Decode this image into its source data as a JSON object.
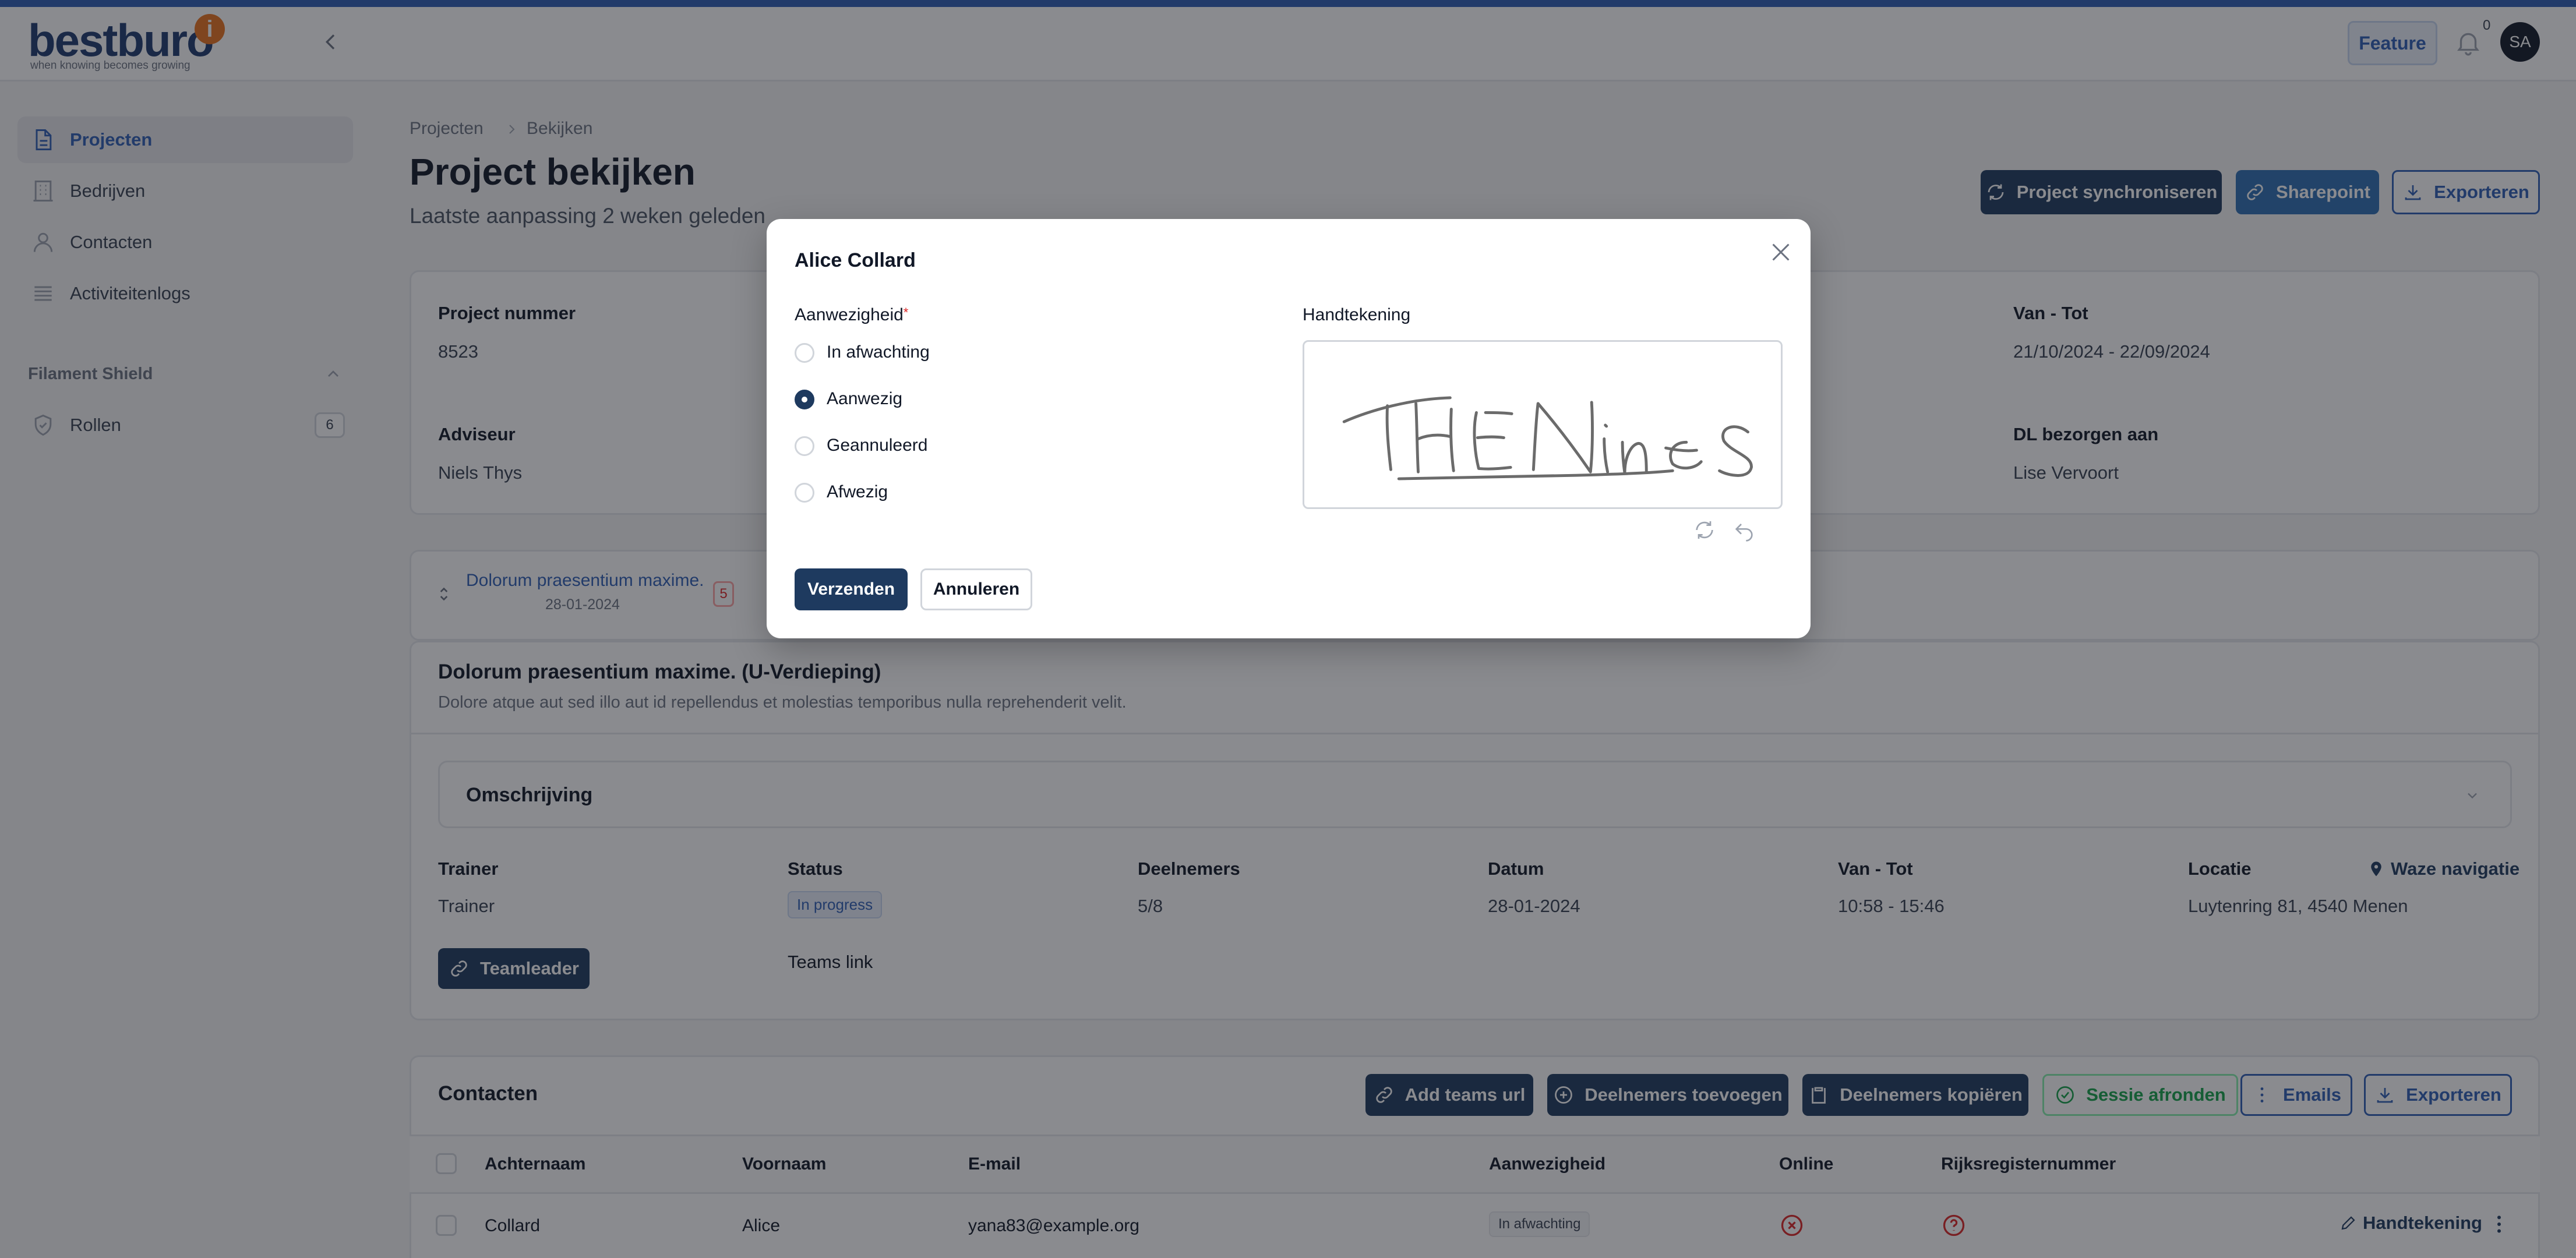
{
  "app": {
    "logo_text": "bestburo",
    "logo_mark": "i",
    "tagline": "when knowing becomes growing",
    "feature_label": "Feature",
    "notification_count": "0",
    "avatar_initials": "SA"
  },
  "sidebar": {
    "items": [
      {
        "label": "Projecten",
        "icon": "document-icon"
      },
      {
        "label": "Bedrijven",
        "icon": "building-icon"
      },
      {
        "label": "Contacten",
        "icon": "user-icon"
      },
      {
        "label": "Activiteitenlogs",
        "icon": "list-icon"
      }
    ],
    "group": {
      "label": "Filament Shield",
      "items": [
        {
          "label": "Rollen",
          "icon": "shield-icon",
          "badge": "6"
        }
      ]
    }
  },
  "breadcrumb": [
    "Projecten",
    "Bekijken"
  ],
  "page": {
    "title": "Project bekijken",
    "subtitle": "Laatste aanpassing 2 weken geleden",
    "actions": [
      "Project synchroniseren",
      "Sharepoint",
      "Exporteren"
    ]
  },
  "project": {
    "number_label": "Project nummer",
    "number": "8523",
    "period_label": "Van - Tot",
    "period": "21/10/2024 - 22/09/2024",
    "advisor_label": "Adviseur",
    "advisor": "Niels Thys",
    "dl_label": "DL bezorgen aan",
    "dl": "Lise Vervoort"
  },
  "session_selector": {
    "title": "Dolorum praesentium maxime.",
    "date": "28-01-2024",
    "count": "5"
  },
  "session": {
    "title": "Dolorum praesentium maxime. (U-Verdieping)",
    "description": "Dolore atque aut sed illo aut id repellendus et molestias temporibus nulla reprehenderit velit.",
    "section": "Omschrijving",
    "trainer_label": "Trainer",
    "trainer": "Trainer",
    "status_label": "Status",
    "status": "In progress",
    "participants_label": "Deelnemers",
    "participants": "5/8",
    "date_label": "Datum",
    "date": "28-01-2024",
    "time_label": "Van - Tot",
    "time": "10:58 - 15:46",
    "location_label": "Locatie",
    "location": "Luytenring 81, 4540 Menen",
    "waze": "Waze navigatie",
    "teamleader": "Teamleader",
    "teams_link": "Teams link"
  },
  "contacts": {
    "title": "Contacten",
    "actions": [
      "Add teams url",
      "Deelnemers toevoegen",
      "Deelnemers kopiëren",
      "Sessie afronden",
      "Emails",
      "Exporteren"
    ],
    "columns": [
      "Achternaam",
      "Voornaam",
      "E-mail",
      "Aanwezigheid",
      "Online",
      "Rijksregisternummer"
    ],
    "rows": [
      {
        "last": "Collard",
        "first": "Alice",
        "email": "yana83@example.org",
        "presence": "In afwachting",
        "action": "Handtekening"
      }
    ]
  },
  "modal": {
    "title": "Alice Collard",
    "presence_label": "Aanwezigheid",
    "required_mark": "*",
    "options": [
      "In afwachting",
      "Aanwezig",
      "Geannuleerd",
      "Afwezig"
    ],
    "selected": "Aanwezig",
    "signature_label": "Handtekening",
    "submit": "Verzenden",
    "cancel": "Annuleren"
  },
  "colors": {
    "primary": "#1e3a5f",
    "accent": "#2f5fb5",
    "success": "#16a34a",
    "danger": "#dc2626"
  }
}
